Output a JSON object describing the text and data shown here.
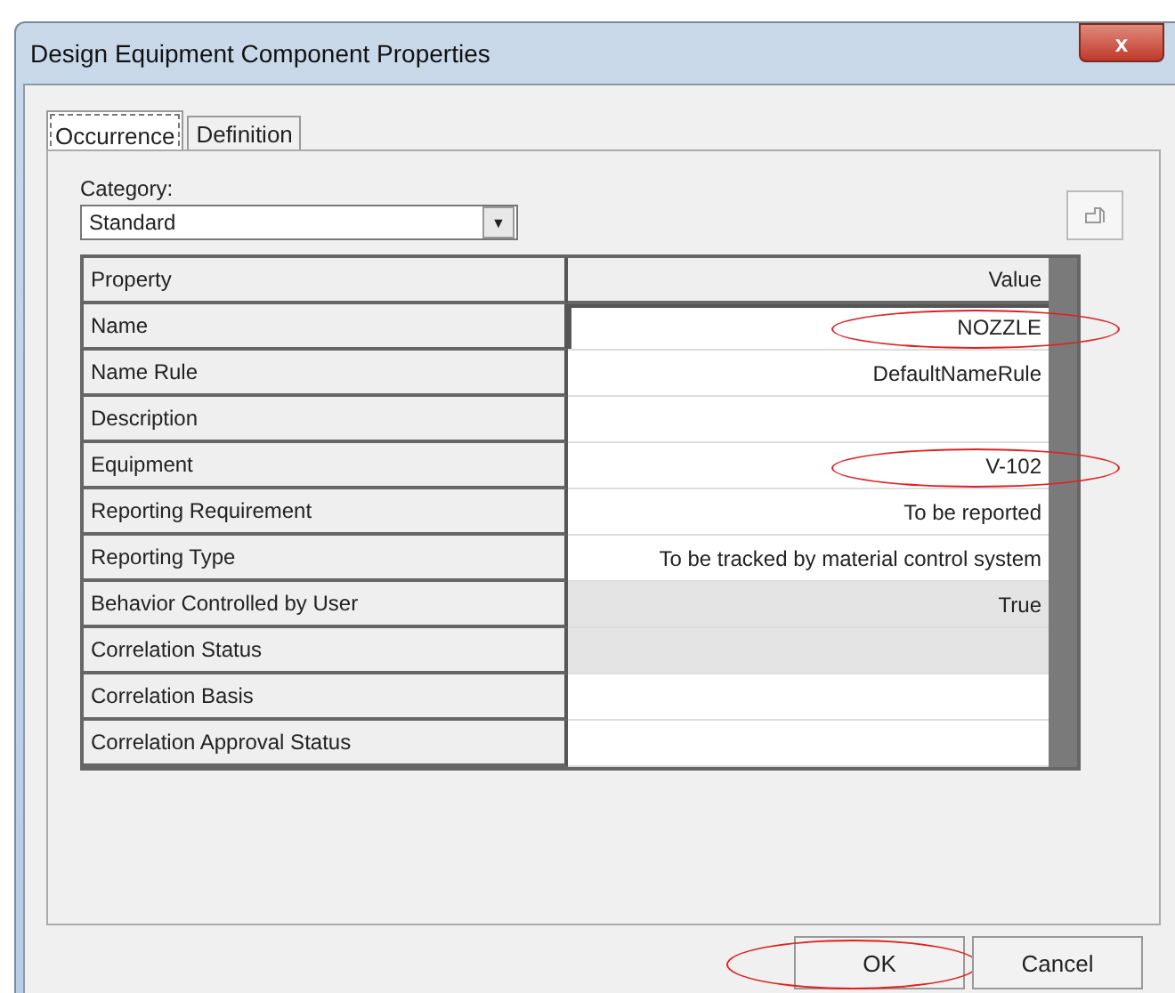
{
  "window": {
    "title": "Design Equipment Component Properties",
    "close": "x"
  },
  "tabs": [
    {
      "label": "Occurrence",
      "selected": true
    },
    {
      "label": "Definition",
      "selected": false
    }
  ],
  "category": {
    "label": "Category:",
    "value": "Standard",
    "arrow": "▼"
  },
  "grid": {
    "columns": [
      "Property",
      "Value"
    ],
    "rows": [
      {
        "property": "Name",
        "value": "NOZZLE",
        "readonly": false,
        "editing": true,
        "circled": true
      },
      {
        "property": "Name Rule",
        "value": "DefaultNameRule",
        "readonly": false,
        "editing": false,
        "circled": false
      },
      {
        "property": "Description",
        "readonly": false,
        "editing": false,
        "circled": false
      },
      {
        "property": "Equipment",
        "value": "V-102",
        "readonly": false,
        "editing": false,
        "circled": true
      },
      {
        "property": "Reporting Requirement",
        "value": "To be reported",
        "readonly": false,
        "editing": false,
        "circled": false
      },
      {
        "property": "Reporting Type",
        "value": "To be tracked by material control system",
        "readonly": false,
        "editing": false,
        "circled": false
      },
      {
        "property": "Behavior Controlled by User",
        "value": "True",
        "readonly": true,
        "editing": false,
        "circled": false
      },
      {
        "property": "Correlation Status",
        "readonly": true,
        "editing": false,
        "circled": false
      },
      {
        "property": "Correlation Basis",
        "readonly": false,
        "editing": false,
        "circled": false
      },
      {
        "property": "Correlation Approval Status",
        "readonly": false,
        "editing": false,
        "circled": false
      }
    ]
  },
  "buttons": [
    {
      "label": "OK",
      "circled": true
    },
    {
      "label": "Cancel",
      "circled": false
    }
  ]
}
